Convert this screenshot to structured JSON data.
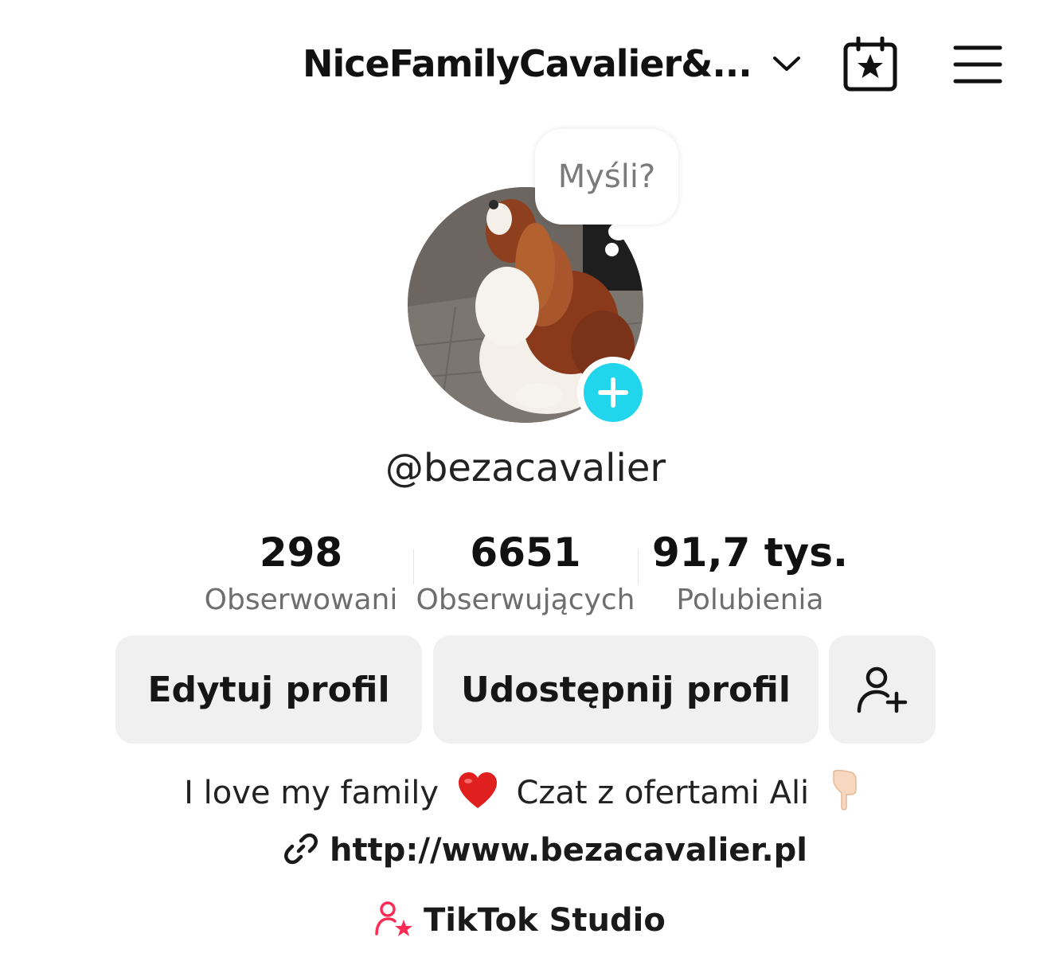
{
  "header": {
    "title": "NiceFamilyCavalier&...",
    "icons": [
      "chevron-down-icon",
      "calendar-star-icon",
      "hamburger-menu-icon"
    ]
  },
  "profile": {
    "thought_bubble": "Myśli?",
    "username": "@bezacavalier",
    "accent_color": "#20d5ec"
  },
  "stats": [
    {
      "value": "298",
      "label": "Obserwowani"
    },
    {
      "value": "6651",
      "label": "Obserwujących"
    },
    {
      "value": "91,7 tys.",
      "label": "Polubienia"
    }
  ],
  "actions": {
    "edit_label": "Edytuj profil",
    "share_label": "Udostępnij profil",
    "add_friend_icon": "add-person-icon"
  },
  "bio": {
    "part1": "I love my family",
    "part2": "Czat z ofertami Ali",
    "link": "http://www.bezacavalier.pl",
    "studio_label": "TikTok Studio",
    "studio_color": "#fe2c55"
  }
}
